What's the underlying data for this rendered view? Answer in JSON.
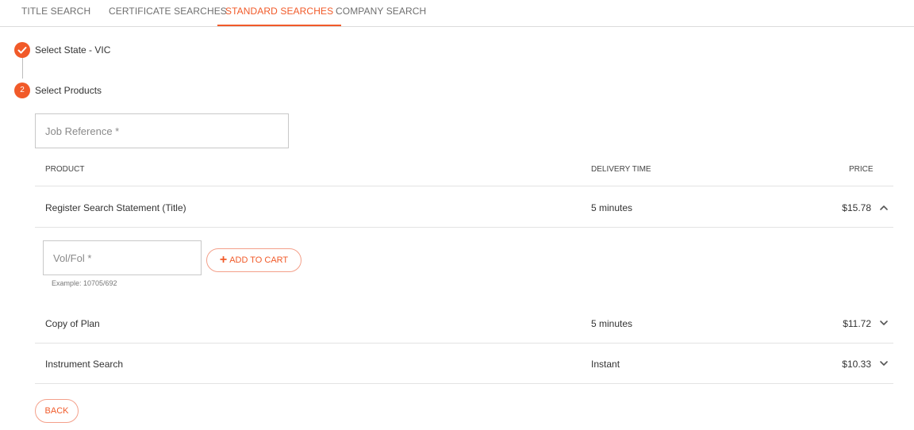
{
  "tabs": [
    {
      "label": "TITLE SEARCH"
    },
    {
      "label": "CERTIFICATE SEARCHES"
    },
    {
      "label": "STANDARD SEARCHES"
    },
    {
      "label": "COMPANY SEARCH"
    }
  ],
  "active_tab": "STANDARD SEARCHES",
  "steps": [
    {
      "icon": "check-icon",
      "label": "Select State - VIC",
      "completed": true
    },
    {
      "number": "2",
      "label": "Select Products",
      "completed": false
    }
  ],
  "job_reference": {
    "placeholder": "Job Reference *",
    "value": ""
  },
  "table": {
    "headers": {
      "product": "PRODUCT",
      "delivery": "DELIVERY TIME",
      "price": "PRICE"
    },
    "rows": [
      {
        "product": "Register Search Statement (Title)",
        "delivery": "5 minutes",
        "price": "$15.78",
        "expanded": true
      },
      {
        "product": "Copy of Plan",
        "delivery": "5 minutes",
        "price": "$11.72",
        "expanded": false
      },
      {
        "product": "Instrument Search",
        "delivery": "Instant",
        "price": "$10.33",
        "expanded": false
      }
    ]
  },
  "expanded_panel": {
    "volfol_placeholder": "Vol/Fol *",
    "volfol_value": "",
    "add_to_cart_label": "ADD TO CART",
    "example": "Example: 10705/692"
  },
  "back_label": "BACK",
  "colors": {
    "accent": "#f15a29",
    "border": "#c8c8c8",
    "divider": "#e3e3e3"
  }
}
